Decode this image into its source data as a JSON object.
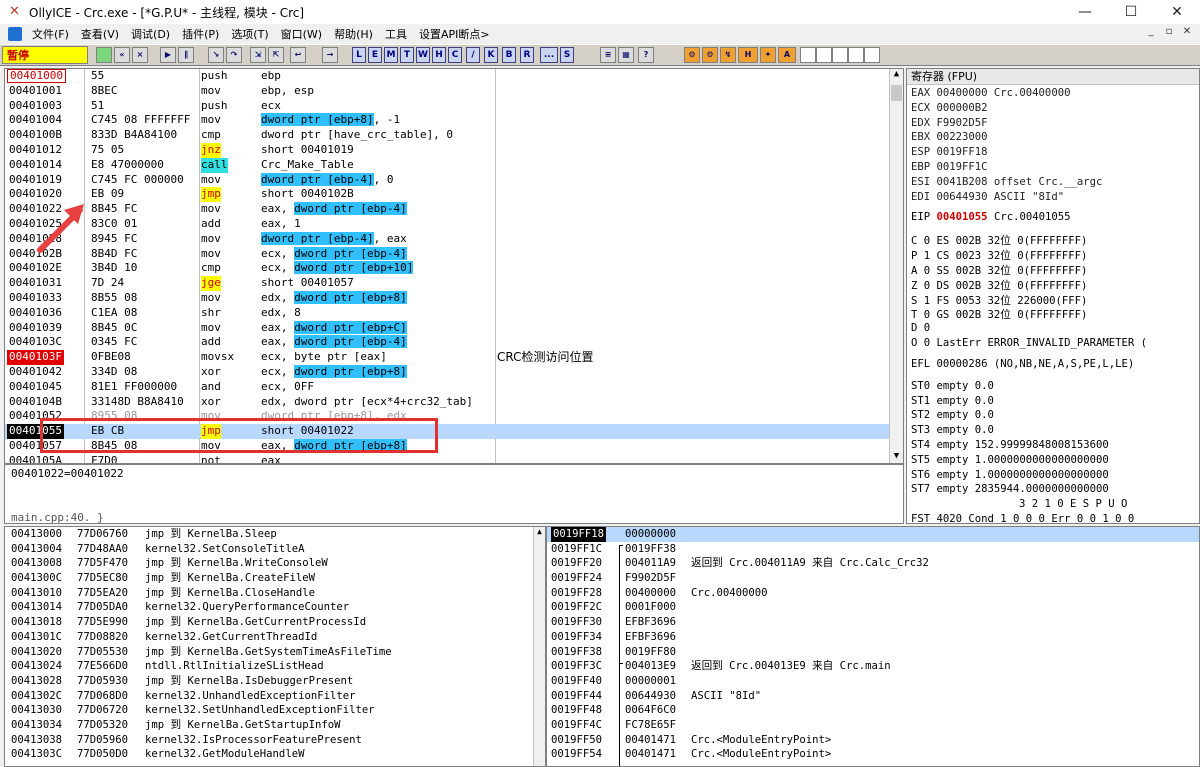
{
  "window": {
    "title": "OllyICE - Crc.exe - [*G.P.U* - 主线程, 模块 - Crc]",
    "min": "—",
    "max": "☐",
    "close": "✕"
  },
  "menu": [
    "文件(F)",
    "查看(V)",
    "调试(D)",
    "插件(P)",
    "选项(T)",
    "窗口(W)",
    "帮助(H)",
    "工具",
    "设置API断点>"
  ],
  "mdi": [
    "_",
    "▫",
    "✕"
  ],
  "toolbar": {
    "status": "暂停",
    "letters": [
      "L",
      "E",
      "M",
      "T",
      "W",
      "H",
      "C",
      "/",
      "K",
      "B",
      "R",
      "...",
      "S"
    ]
  },
  "cpu": {
    "rows": [
      {
        "addr": "00401000",
        "hex": "55",
        "asm": "push",
        "opr": "ebp",
        "style": "redaddr"
      },
      {
        "addr": "00401001",
        "hex": "8BEC",
        "asm": "mov",
        "opr": "ebp, esp"
      },
      {
        "addr": "00401003",
        "hex": "51",
        "asm": "push",
        "opr": "ecx"
      },
      {
        "addr": "00401004",
        "hex": "C745 08 FFFFFFF",
        "asm": "mov",
        "opr_hl": "dword ptr [ebp+8]",
        "opr_rest": ", -1"
      },
      {
        "addr": "0040100B",
        "hex": "833D B4A84100",
        "asm": "cmp",
        "opr": "dword ptr [have_crc_table], 0"
      },
      {
        "addr": "00401012",
        "hex": "75 05",
        "asm": "jnz",
        "opr": "short 00401019",
        "asm_style": "yel"
      },
      {
        "addr": "00401014",
        "hex": "E8 47000000",
        "asm": "call",
        "opr": "Crc_Make_Table",
        "asm_style": "cyan"
      },
      {
        "addr": "00401019",
        "hex": "C745 FC 000000",
        "asm": "mov",
        "opr_hl": "dword ptr [ebp-4]",
        "opr_rest": ", 0"
      },
      {
        "addr": "00401020",
        "hex": "EB 09",
        "asm": "jmp",
        "opr": "short 0040102B",
        "asm_style": "yel"
      },
      {
        "addr": "00401022",
        "hex": "8B45 FC",
        "asm": "mov",
        "opr_pre": "eax, ",
        "opr_hl": "dword ptr [ebp-4]",
        "opr_rest": ""
      },
      {
        "addr": "00401025",
        "hex": "83C0 01",
        "asm": "add",
        "opr": "eax, 1"
      },
      {
        "addr": "00401028",
        "hex": "8945 FC",
        "asm": "mov",
        "opr_hl": "dword ptr [ebp-4]",
        "opr_rest": ", eax"
      },
      {
        "addr": "0040102B",
        "hex": "8B4D FC",
        "asm": "mov",
        "opr_pre": "ecx, ",
        "opr_hl": "dword ptr [ebp-4]",
        "opr_rest": ""
      },
      {
        "addr": "0040102E",
        "hex": "3B4D 10",
        "asm": "cmp",
        "opr_pre": "ecx, ",
        "opr_hl": "dword ptr [ebp+10]",
        "opr_rest": ""
      },
      {
        "addr": "00401031",
        "hex": "7D 24",
        "asm": "jge",
        "opr": "short 00401057",
        "asm_style": "yel"
      },
      {
        "addr": "00401033",
        "hex": "8B55 08",
        "asm": "mov",
        "opr_pre": "edx, ",
        "opr_hl": "dword ptr [ebp+8]",
        "opr_rest": ""
      },
      {
        "addr": "00401036",
        "hex": "C1EA 08",
        "asm": "shr",
        "opr": "edx, 8"
      },
      {
        "addr": "00401039",
        "hex": "8B45 0C",
        "asm": "mov",
        "opr_pre": "eax, ",
        "opr_hl": "dword ptr [ebp+C]",
        "opr_rest": ""
      },
      {
        "addr": "0040103C",
        "hex": "0345 FC",
        "asm": "add",
        "opr_pre": "eax, ",
        "opr_hl": "dword ptr [ebp-4]",
        "opr_rest": ""
      },
      {
        "addr": "0040103F",
        "hex": "0FBE08",
        "asm": "movsx",
        "opr": "ecx, byte ptr [eax]",
        "style": "bp",
        "comment": "CRC检测访问位置"
      },
      {
        "addr": "00401042",
        "hex": "334D 08",
        "asm": "xor",
        "opr_pre": "ecx, ",
        "opr_hl": "dword ptr [ebp+8]",
        "opr_rest": ""
      },
      {
        "addr": "00401045",
        "hex": "81E1 FF000000",
        "asm": "and",
        "opr": "ecx, 0FF"
      },
      {
        "addr": "0040104B",
        "hex": "33148D B8A8410",
        "asm": "xor",
        "opr": "edx, dword ptr [ecx*4+crc32_tab]"
      },
      {
        "addr": "00401052",
        "hex": "8955 08",
        "asm": "mov",
        "opr": "dword ptr [ebp+8], edx",
        "style": "partial"
      },
      {
        "addr": "00401055",
        "hex": "EB CB",
        "asm": "jmp",
        "opr": "short 00401022",
        "style": "eip",
        "asm_style": "yel"
      },
      {
        "addr": "00401057",
        "hex": "8B45 08",
        "asm": "mov",
        "opr_pre": "eax, ",
        "opr_hl": "dword ptr [ebp+8]",
        "opr_rest": ""
      },
      {
        "addr": "0040105A",
        "hex": "F7D0",
        "asm": "not",
        "opr": "eax"
      }
    ]
  },
  "info": {
    "line1": "00401022=00401022",
    "line2": "main.cpp:40.  }"
  },
  "registers": {
    "title": "寄存器 (FPU)",
    "lines": [
      "EAX 00400000 Crc.00400000",
      "ECX 000000B2",
      "EDX F9902D5F",
      "EBX 00223000",
      "ESP 0019FF18",
      "EBP 0019FF1C",
      "ESI 0041B208 offset Crc.__argc",
      "EDI 00644930 ASCII \"8Id\""
    ],
    "eip": {
      "label": "EIP",
      "value": "00401055",
      "desc": "Crc.00401055"
    },
    "flags": [
      "C 0  ES 002B 32位 0(FFFFFFFF)",
      "P 1  CS 0023 32位 0(FFFFFFFF)",
      "A 0  SS 002B 32位 0(FFFFFFFF)",
      "Z 0  DS 002B 32位 0(FFFFFFFF)",
      "S 1  FS 0053 32位 226000(FFF)",
      "T 0  GS 002B 32位 0(FFFFFFFF)",
      "D 0",
      "O 0  LastErr ERROR_INVALID_PARAMETER ("
    ],
    "efl": "EFL 00000286 (NO,NB,NE,A,S,PE,L,LE)",
    "fpu": [
      "ST0 empty 0.0",
      "ST1 empty 0.0",
      "ST2 empty 0.0",
      "ST3 empty 0.0",
      "ST4 empty 152.99999848008153600",
      "ST5 empty 1.0000000000000000000",
      "ST6 empty 1.0000000000000000000",
      "ST7 empty 2835944.0000000000000"
    ],
    "fpu_hdr": "3 2 1 0      E S P U O",
    "fst": "FST 4020  Cond 1 0 0 0  Err 0 0 1 0 0"
  },
  "imports": [
    [
      "00413000",
      "77D06760",
      "jmp 到 KernelBa.Sleep"
    ],
    [
      "00413004",
      "77D48AA0",
      "kernel32.SetConsoleTitleA"
    ],
    [
      "00413008",
      "77D5F470",
      "jmp 到 KernelBa.WriteConsoleW"
    ],
    [
      "0041300C",
      "77D5EC80",
      "jmp 到 KernelBa.CreateFileW"
    ],
    [
      "00413010",
      "77D5EA20",
      "jmp 到 KernelBa.CloseHandle"
    ],
    [
      "00413014",
      "77D05DA0",
      "kernel32.QueryPerformanceCounter"
    ],
    [
      "00413018",
      "77D5E990",
      "jmp 到 KernelBa.GetCurrentProcessId"
    ],
    [
      "0041301C",
      "77D08820",
      "kernel32.GetCurrentThreadId"
    ],
    [
      "00413020",
      "77D05530",
      "jmp 到 KernelBa.GetSystemTimeAsFileTime"
    ],
    [
      "00413024",
      "77E566D0",
      "ntdll.RtlInitializeSListHead"
    ],
    [
      "00413028",
      "77D05930",
      "jmp 到 KernelBa.IsDebuggerPresent"
    ],
    [
      "0041302C",
      "77D068D0",
      "kernel32.UnhandledExceptionFilter"
    ],
    [
      "00413030",
      "77D06720",
      "kernel32.SetUnhandledExceptionFilter"
    ],
    [
      "00413034",
      "77D05320",
      "jmp 到 KernelBa.GetStartupInfoW"
    ],
    [
      "00413038",
      "77D05960",
      "kernel32.IsProcessorFeaturePresent"
    ],
    [
      "0041303C",
      "77D050D0",
      "kernel32.GetModuleHandleW"
    ]
  ],
  "stack": [
    [
      "0019FF18",
      "00000000",
      ""
    ],
    [
      "0019FF1C",
      "0019FF38",
      ""
    ],
    [
      "0019FF20",
      "004011A9",
      "返回到 Crc.004011A9 来自 Crc.Calc_Crc32"
    ],
    [
      "0019FF24",
      "F9902D5F",
      ""
    ],
    [
      "0019FF28",
      "00400000",
      "Crc.00400000"
    ],
    [
      "0019FF2C",
      "0001F000",
      ""
    ],
    [
      "0019FF30",
      "EFBF3696",
      ""
    ],
    [
      "0019FF34",
      "EFBF3696",
      ""
    ],
    [
      "0019FF38",
      "0019FF80",
      ""
    ],
    [
      "0019FF3C",
      "004013E9",
      "返回到 Crc.004013E9 来自 Crc.main"
    ],
    [
      "0019FF40",
      "00000001",
      ""
    ],
    [
      "0019FF44",
      "00644930",
      "ASCII \"8Id\""
    ],
    [
      "0019FF48",
      "0064F6C0",
      ""
    ],
    [
      "0019FF4C",
      "FC78E65F",
      ""
    ],
    [
      "0019FF50",
      "00401471",
      "Crc.<ModuleEntryPoint>"
    ],
    [
      "0019FF54",
      "00401471",
      "Crc.<ModuleEntryPoint>"
    ]
  ]
}
